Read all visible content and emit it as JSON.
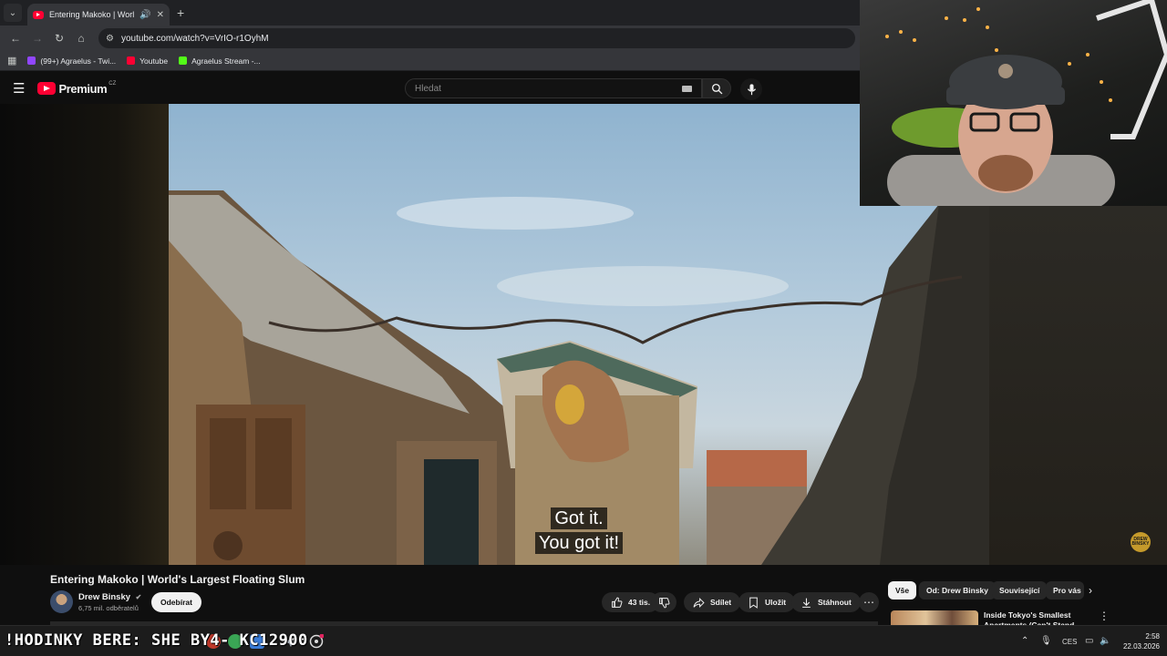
{
  "browser": {
    "tab_title": "Entering Makoko | World's",
    "url": "youtube.com/watch?v=VrIO-r1OyhM",
    "bookmarks": [
      {
        "label": "(99+) Agraelus - Twi...",
        "icon": "twitch-icon",
        "color": "#9146ff"
      },
      {
        "label": "Youtube",
        "icon": "youtube-icon",
        "color": "#ff0033"
      },
      {
        "label": "Agraelus Stream -...",
        "icon": "kick-icon",
        "color": "#53fc18"
      }
    ]
  },
  "youtube": {
    "logo_text": "Premium",
    "region": "CZ",
    "search_placeholder": "Hledat"
  },
  "video": {
    "subtitle_line1": "Got it.",
    "subtitle_line2": "You got it!",
    "title": "Entering Makoko | World's Largest Floating Slum",
    "watermark": "DREW BINSKY"
  },
  "channel": {
    "name": "Drew Binsky",
    "verified_icon": "verified-check-icon",
    "subscribers": "6,75 mil. odběratelů",
    "subscribe_label": "Odebírat"
  },
  "actions": {
    "likes": "43 tis.",
    "share": "Sdílet",
    "save": "Uložit",
    "download": "Stáhnout"
  },
  "chips": [
    "Vše",
    "Od: Drew Binsky",
    "Související",
    "Pro vás"
  ],
  "recommendation": {
    "title": "Inside Tokyo's Smallest Apartments (Can't Stand Up)"
  },
  "taskbar": {
    "overlay_text": "!HODINKY BERE: SHE  BY4- KC12900",
    "language": "CES",
    "time": "2:58",
    "date": "22.03.2026"
  },
  "colors": {
    "youtube_red": "#ff0033",
    "background": "#0f0f0f",
    "chip_active": "#f1f1f1"
  }
}
